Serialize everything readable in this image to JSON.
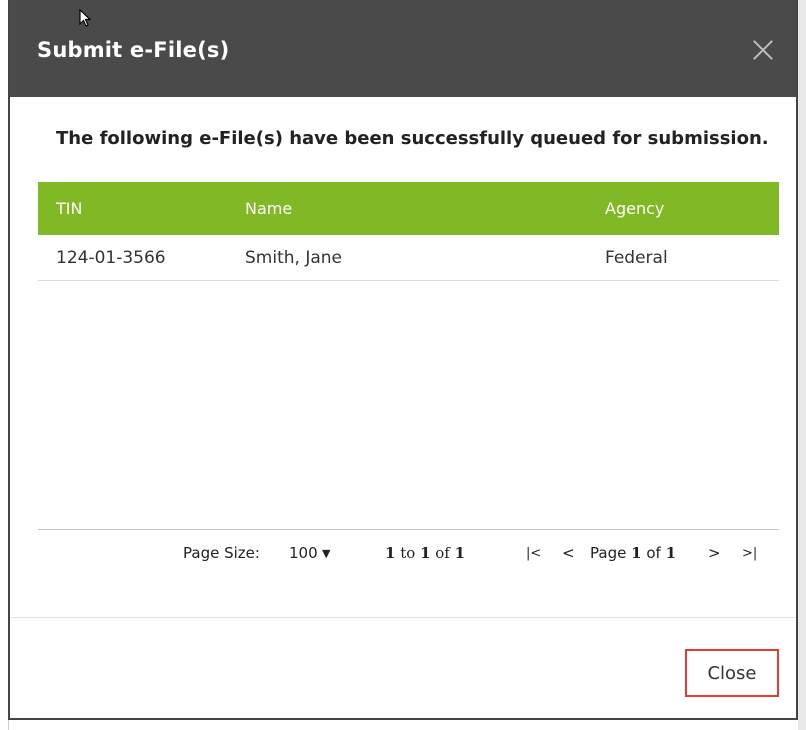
{
  "dialog": {
    "title": "Submit e-File(s)",
    "message": "The following e-File(s) have been successfully queued for submission.",
    "close_label": "Close"
  },
  "grid": {
    "columns": [
      "TIN",
      "Name",
      "Agency"
    ],
    "rows": [
      {
        "tin": "124-01-3566",
        "name": "Smith, Jane",
        "agency": "Federal"
      }
    ]
  },
  "pager": {
    "page_size_label": "Page Size:",
    "page_size_value": "100",
    "range_from": "1",
    "range_to_word": "to",
    "range_to": "1",
    "range_of_word": "of",
    "range_total": "1",
    "page_word": "Page",
    "page_current": "1",
    "page_of_word": "of",
    "page_total": "1"
  },
  "icons": {
    "close": "close-icon",
    "caret": "caret-down-icon",
    "first": "first-page-icon",
    "prev": "prev-page-icon",
    "next": "next-page-icon",
    "last": "last-page-icon"
  },
  "colors": {
    "header_bg": "#4a4a4a",
    "grid_header_bg": "#80b826",
    "close_highlight": "#e53935"
  }
}
